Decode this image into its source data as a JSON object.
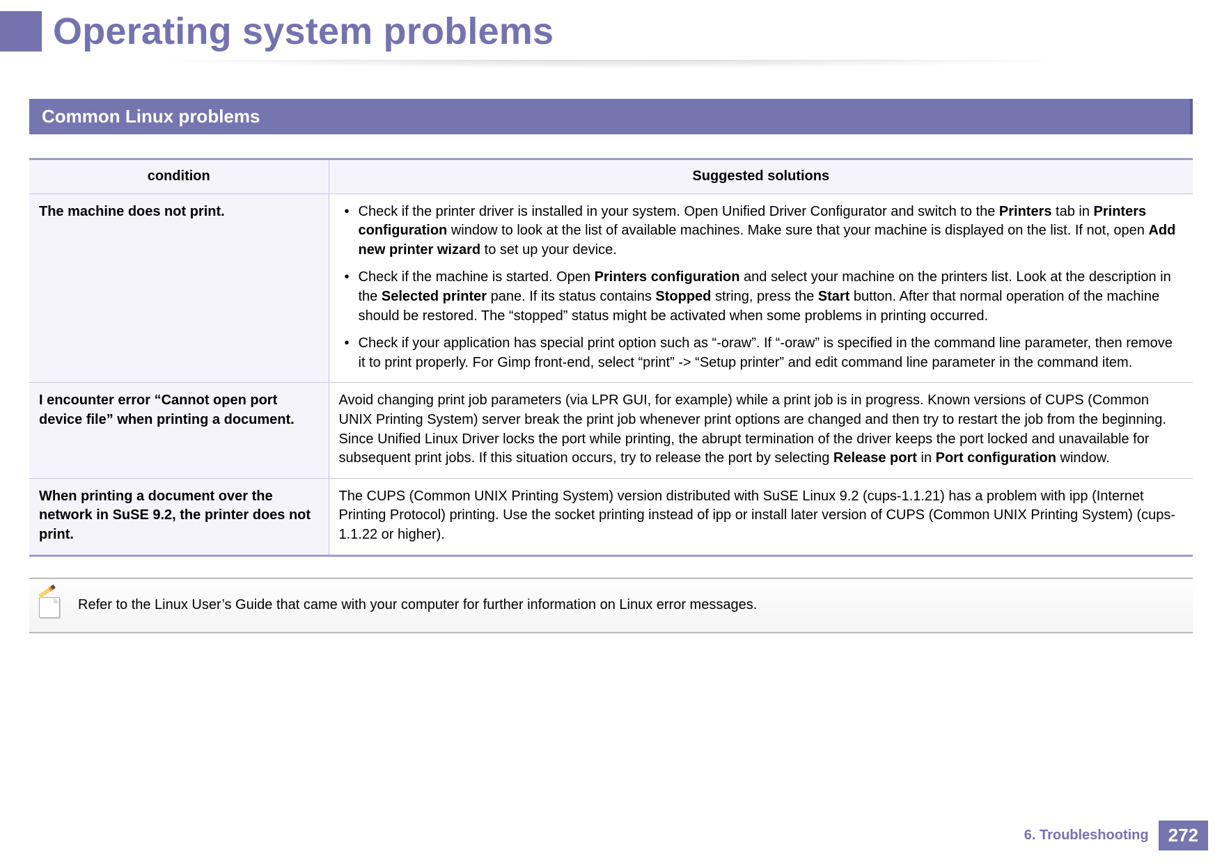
{
  "page_title": "Operating system problems",
  "section_bar": "Common Linux problems",
  "table": {
    "headers": {
      "condition": "condition",
      "solution": "Suggested solutions"
    },
    "rows": [
      {
        "condition": "The machine does not print.",
        "solution_html": "<ul><li>Check if the printer driver is installed in your system. Open Unified Driver Configurator and switch to the <span class='b'>Printers</span> tab in <span class='b'>Printers configuration</span> window to look at the list of available machines. Make sure that your machine is displayed on the list. If not, open <span class='b'>Add new printer wizard</span> to set up your device.</li><li>Check if the machine is started. Open <span class='b'>Printers configuration</span> and select your machine on the printers list. Look at the description in the <span class='b'>Selected printer</span> pane. If its status contains <span class='b'>Stopped</span> string, press the <span class='b'>Start</span> button. After that normal operation of the machine should be restored. The “stopped” status might be activated when some problems in printing occurred.</li><li>Check if your application has special print option such as “-oraw”. If “-oraw” is specified in the command line parameter, then remove it to print properly. For Gimp front-end, select “print” -> “Setup printer” and edit command line parameter in the command item.</li></ul>"
      },
      {
        "condition": "I encounter error “Cannot open port device file” when printing a document.",
        "solution_html": "Avoid changing print job parameters (via LPR GUI, for example) while a print job is in progress. Known versions of CUPS (Common UNIX Printing System) server break the print job whenever print options are changed and then try to restart the job from the beginning. Since Unified Linux Driver locks the port while printing, the abrupt termination of the driver keeps the port locked and unavailable for subsequent print jobs. If this situation occurs, try to release the port by selecting <span class='b'>Release port</span> in <span class='b'>Port configuration</span> window."
      },
      {
        "condition": "When printing a document over the network in SuSE 9.2, the printer does not print.",
        "solution_html": "The CUPS (Common UNIX Printing System) version distributed with SuSE Linux 9.2 (cups-1.1.21) has a problem with ipp (Internet Printing Protocol) printing. Use the socket printing instead of ipp or install later version of CUPS (Common UNIX Printing System) (cups-1.1.22 or higher)."
      }
    ]
  },
  "note_text": "Refer to the Linux User’s Guide that came with your computer for further information on Linux error messages.",
  "footer": {
    "chapter": "6.  Troubleshooting",
    "page_number": "272"
  }
}
